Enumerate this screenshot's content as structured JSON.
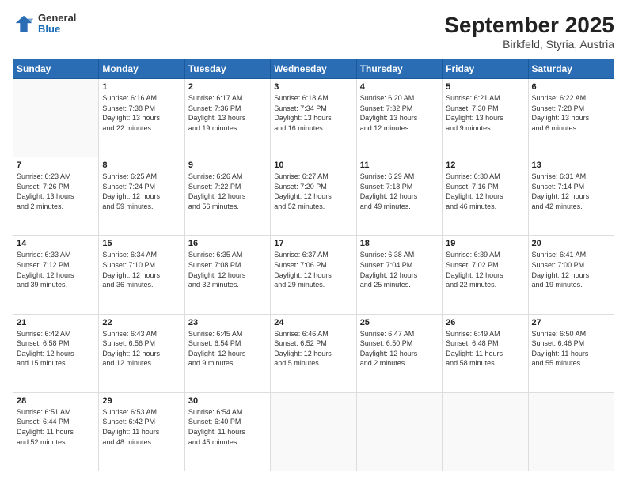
{
  "header": {
    "logo_general": "General",
    "logo_blue": "Blue",
    "title": "September 2025",
    "location": "Birkfeld, Styria, Austria"
  },
  "weekdays": [
    "Sunday",
    "Monday",
    "Tuesday",
    "Wednesday",
    "Thursday",
    "Friday",
    "Saturday"
  ],
  "weeks": [
    [
      {
        "day": "",
        "info": ""
      },
      {
        "day": "1",
        "info": "Sunrise: 6:16 AM\nSunset: 7:38 PM\nDaylight: 13 hours\nand 22 minutes."
      },
      {
        "day": "2",
        "info": "Sunrise: 6:17 AM\nSunset: 7:36 PM\nDaylight: 13 hours\nand 19 minutes."
      },
      {
        "day": "3",
        "info": "Sunrise: 6:18 AM\nSunset: 7:34 PM\nDaylight: 13 hours\nand 16 minutes."
      },
      {
        "day": "4",
        "info": "Sunrise: 6:20 AM\nSunset: 7:32 PM\nDaylight: 13 hours\nand 12 minutes."
      },
      {
        "day": "5",
        "info": "Sunrise: 6:21 AM\nSunset: 7:30 PM\nDaylight: 13 hours\nand 9 minutes."
      },
      {
        "day": "6",
        "info": "Sunrise: 6:22 AM\nSunset: 7:28 PM\nDaylight: 13 hours\nand 6 minutes."
      }
    ],
    [
      {
        "day": "7",
        "info": "Sunrise: 6:23 AM\nSunset: 7:26 PM\nDaylight: 13 hours\nand 2 minutes."
      },
      {
        "day": "8",
        "info": "Sunrise: 6:25 AM\nSunset: 7:24 PM\nDaylight: 12 hours\nand 59 minutes."
      },
      {
        "day": "9",
        "info": "Sunrise: 6:26 AM\nSunset: 7:22 PM\nDaylight: 12 hours\nand 56 minutes."
      },
      {
        "day": "10",
        "info": "Sunrise: 6:27 AM\nSunset: 7:20 PM\nDaylight: 12 hours\nand 52 minutes."
      },
      {
        "day": "11",
        "info": "Sunrise: 6:29 AM\nSunset: 7:18 PM\nDaylight: 12 hours\nand 49 minutes."
      },
      {
        "day": "12",
        "info": "Sunrise: 6:30 AM\nSunset: 7:16 PM\nDaylight: 12 hours\nand 46 minutes."
      },
      {
        "day": "13",
        "info": "Sunrise: 6:31 AM\nSunset: 7:14 PM\nDaylight: 12 hours\nand 42 minutes."
      }
    ],
    [
      {
        "day": "14",
        "info": "Sunrise: 6:33 AM\nSunset: 7:12 PM\nDaylight: 12 hours\nand 39 minutes."
      },
      {
        "day": "15",
        "info": "Sunrise: 6:34 AM\nSunset: 7:10 PM\nDaylight: 12 hours\nand 36 minutes."
      },
      {
        "day": "16",
        "info": "Sunrise: 6:35 AM\nSunset: 7:08 PM\nDaylight: 12 hours\nand 32 minutes."
      },
      {
        "day": "17",
        "info": "Sunrise: 6:37 AM\nSunset: 7:06 PM\nDaylight: 12 hours\nand 29 minutes."
      },
      {
        "day": "18",
        "info": "Sunrise: 6:38 AM\nSunset: 7:04 PM\nDaylight: 12 hours\nand 25 minutes."
      },
      {
        "day": "19",
        "info": "Sunrise: 6:39 AM\nSunset: 7:02 PM\nDaylight: 12 hours\nand 22 minutes."
      },
      {
        "day": "20",
        "info": "Sunrise: 6:41 AM\nSunset: 7:00 PM\nDaylight: 12 hours\nand 19 minutes."
      }
    ],
    [
      {
        "day": "21",
        "info": "Sunrise: 6:42 AM\nSunset: 6:58 PM\nDaylight: 12 hours\nand 15 minutes."
      },
      {
        "day": "22",
        "info": "Sunrise: 6:43 AM\nSunset: 6:56 PM\nDaylight: 12 hours\nand 12 minutes."
      },
      {
        "day": "23",
        "info": "Sunrise: 6:45 AM\nSunset: 6:54 PM\nDaylight: 12 hours\nand 9 minutes."
      },
      {
        "day": "24",
        "info": "Sunrise: 6:46 AM\nSunset: 6:52 PM\nDaylight: 12 hours\nand 5 minutes."
      },
      {
        "day": "25",
        "info": "Sunrise: 6:47 AM\nSunset: 6:50 PM\nDaylight: 12 hours\nand 2 minutes."
      },
      {
        "day": "26",
        "info": "Sunrise: 6:49 AM\nSunset: 6:48 PM\nDaylight: 11 hours\nand 58 minutes."
      },
      {
        "day": "27",
        "info": "Sunrise: 6:50 AM\nSunset: 6:46 PM\nDaylight: 11 hours\nand 55 minutes."
      }
    ],
    [
      {
        "day": "28",
        "info": "Sunrise: 6:51 AM\nSunset: 6:44 PM\nDaylight: 11 hours\nand 52 minutes."
      },
      {
        "day": "29",
        "info": "Sunrise: 6:53 AM\nSunset: 6:42 PM\nDaylight: 11 hours\nand 48 minutes."
      },
      {
        "day": "30",
        "info": "Sunrise: 6:54 AM\nSunset: 6:40 PM\nDaylight: 11 hours\nand 45 minutes."
      },
      {
        "day": "",
        "info": ""
      },
      {
        "day": "",
        "info": ""
      },
      {
        "day": "",
        "info": ""
      },
      {
        "day": "",
        "info": ""
      }
    ]
  ]
}
